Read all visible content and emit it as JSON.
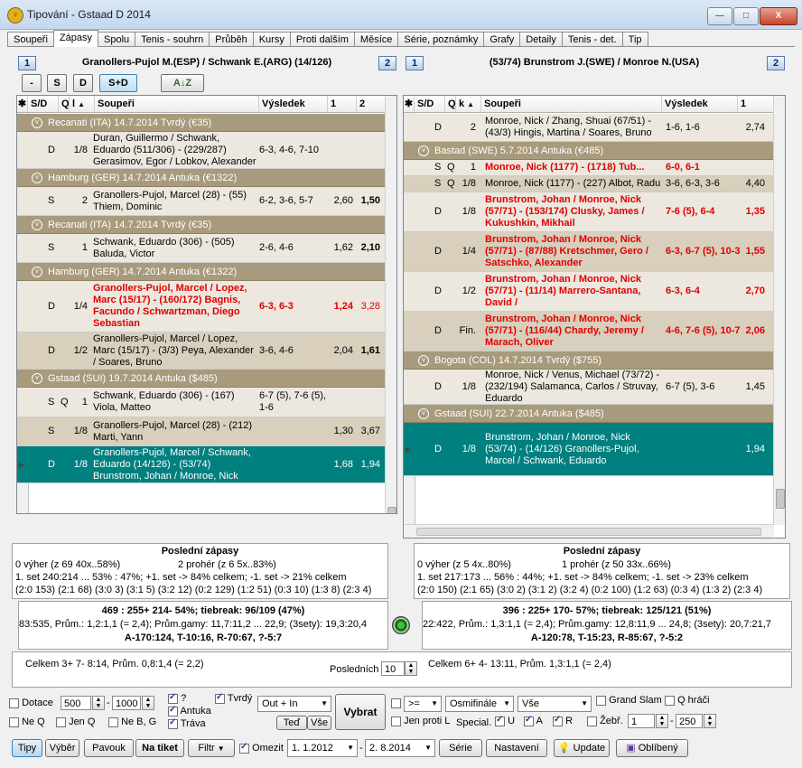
{
  "window": {
    "title": "Tipování - Gstaad D 2014",
    "min": "—",
    "max": "□",
    "close": "X"
  },
  "tabs": [
    "Soupeři",
    "Zápasy",
    "Spolu",
    "Tenis - souhrn",
    "Průběh",
    "Kursy",
    "Proti dalším",
    "Měsíce",
    "Série, poznámky",
    "Grafy",
    "Detaily",
    "Tenis - det.",
    "Tip"
  ],
  "left": {
    "num1": "1",
    "num2": "2",
    "match": "Granollers-Pujol M.(ESP) / Schwank E.(ARG) (14/126)",
    "filters": [
      "-",
      "S",
      "D",
      "S+D"
    ],
    "sort_icon": "A↓Z",
    "headers": [
      "S/D",
      "Q",
      "l",
      "Soupeři",
      "Výsledek",
      "1",
      "2"
    ],
    "rows": [
      {
        "type": "group",
        "text": "Recanati (ITA) 14.7.2014  Tvrdý  (€35)"
      },
      {
        "type": "row",
        "sd": "D",
        "q": "",
        "round": "1/8",
        "opp": "Duran, Guillermo / Schwank, Eduardo (511/306) - (229/287) Gerasimov, Egor / Lobkov, Alexander",
        "res": "6-3, 4-6, 7-10",
        "o1": "",
        "o2": "",
        "red": false,
        "bold2": false
      },
      {
        "type": "group",
        "text": "Hamburg (GER) 14.7.2014  Antuka  (€1322)"
      },
      {
        "type": "row",
        "sd": "S",
        "q": "",
        "round": "2",
        "opp": "Granollers-Pujol, Marcel (28) - (55) Thiem, Dominic",
        "res": "6-2, 3-6, 5-7",
        "o1": "2,60",
        "o2": "1,50",
        "red": false,
        "bold2": true
      },
      {
        "type": "group",
        "text": "Recanati (ITA) 14.7.2014  Tvrdý  (€35)"
      },
      {
        "type": "row",
        "sd": "S",
        "q": "",
        "round": "1",
        "opp": "Schwank, Eduardo (306) - (505) Baluda, Victor",
        "res": "2-6, 4-6",
        "o1": "1,62",
        "o2": "2,10",
        "red": false,
        "bold2": true
      },
      {
        "type": "group",
        "text": "Hamburg (GER) 14.7.2014  Antuka  (€1322)"
      },
      {
        "type": "row",
        "sd": "D",
        "q": "",
        "round": "1/4",
        "opp": "Granollers-Pujol, Marcel / Lopez, Marc (15/17) - (160/172) Bagnis, Facundo / Schwartzman, Diego Sebastian",
        "res": "6-3, 6-3",
        "o1": "1,24",
        "o2": "3,28",
        "red": true,
        "bold2": false
      },
      {
        "type": "row",
        "sd": "D",
        "q": "",
        "round": "1/2",
        "opp": "Granollers-Pujol, Marcel / Lopez, Marc (15/17) - (3/3) Peya, Alexander / Soares, Bruno",
        "res": "3-6, 4-6",
        "o1": "2,04",
        "o2": "1,61",
        "red": false,
        "bold2": true
      },
      {
        "type": "group",
        "text": "Gstaad (SUI) 19.7.2014  Antuka  ($485)"
      },
      {
        "type": "row",
        "sd": "S",
        "q": "Q",
        "round": "1",
        "opp": "Schwank, Eduardo (306) - (167) Viola, Matteo",
        "res": "6-7 (5), 7-6 (5), 1-6",
        "o1": "",
        "o2": "",
        "red": false,
        "bold2": false
      },
      {
        "type": "row",
        "sd": "S",
        "q": "",
        "round": "1/8",
        "opp": "Granollers-Pujol, Marcel (28) - (212) Marti, Yann",
        "res": "",
        "o1": "1,30",
        "o2": "3,67",
        "red": false,
        "bold2": false
      },
      {
        "type": "row",
        "sd": "D",
        "q": "",
        "round": "1/8",
        "opp": "Granollers-Pujol, Marcel / Schwank, Eduardo (14/126) - (53/74) Brunstrom, Johan / Monroe, Nick",
        "res": "",
        "o1": "1,68",
        "o2": "1,94",
        "red": false,
        "bold2": false,
        "selected": true
      }
    ]
  },
  "right": {
    "num1": "1",
    "num2": "2",
    "match": "(53/74) Brunstrom J.(SWE) / Monroe N.(USA)",
    "headers": [
      "S/D",
      "Q",
      "k",
      "Soupeři",
      "Výsledek",
      "1"
    ],
    "rows": [
      {
        "type": "row",
        "sd": "D",
        "q": "",
        "round": "2",
        "opp": "Monroe, Nick / Zhang, Shuai (67/51) - (43/3) Hingis, Martina / Soares, Bruno",
        "res": "1-6, 1-6",
        "o1": "2,74",
        "red": false
      },
      {
        "type": "group",
        "text": "Bastad (SWE) 5.7.2014  Antuka  (€485)"
      },
      {
        "type": "row",
        "sd": "S",
        "q": "Q",
        "round": "1",
        "opp": "Monroe, Nick (1177) - (1718) Tub...",
        "res": "6-0, 6-1",
        "o1": "",
        "red": true
      },
      {
        "type": "row",
        "sd": "S",
        "q": "Q",
        "round": "1/8",
        "opp": "Monroe, Nick (1177) - (227) Albot, Radu",
        "res": "3-6, 6-3, 3-6",
        "o1": "4,40",
        "red": false
      },
      {
        "type": "row",
        "sd": "D",
        "q": "",
        "round": "1/8",
        "opp": "Brunstrom, Johan / Monroe, Nick (57/71) - (153/174) Clusky, James / Kukushkin, Mikhail",
        "res": "7-6 (5), 6-4",
        "o1": "1,35",
        "red": true
      },
      {
        "type": "row",
        "sd": "D",
        "q": "",
        "round": "1/4",
        "opp": "Brunstrom, Johan / Monroe, Nick (57/71) - (87/88) Kretschmer, Gero / Satschko, Alexander",
        "res": "6-3, 6-7 (5), 10-3",
        "o1": "1,55",
        "red": true
      },
      {
        "type": "row",
        "sd": "D",
        "q": "",
        "round": "1/2",
        "opp": "Brunstrom, Johan / Monroe, Nick (57/71) - (11/14) Marrero-Santana, David /",
        "res": "6-3, 6-4",
        "o1": "2,70",
        "red": true
      },
      {
        "type": "row",
        "sd": "D",
        "q": "",
        "round": "Fin.",
        "opp": "Brunstrom, Johan / Monroe, Nick (57/71) - (116/44) Chardy, Jeremy / Marach, Oliver",
        "res": "4-6, 7-6 (5), 10-7",
        "o1": "2,06",
        "red": true
      },
      {
        "type": "group",
        "text": "Bogota (COL) 14.7.2014  Tvrdý  ($755)"
      },
      {
        "type": "row",
        "sd": "D",
        "q": "",
        "round": "1/8",
        "opp": "Monroe, Nick / Venus, Michael (73/72) - (232/194) Salamanca, Carlos / Struvay, Eduardo",
        "res": "6-7 (5), 3-6",
        "o1": "1,45",
        "red": false
      },
      {
        "type": "group",
        "text": "Gstaad (SUI) 22.7.2014  Antuka  ($485)"
      },
      {
        "type": "row",
        "sd": "D",
        "q": "",
        "round": "1/8",
        "opp": "Brunstrom, Johan / Monroe, Nick (53/74) - (14/126) Granollers-Pujol, Marcel / Schwank, Eduardo",
        "res": "",
        "o1": "1,94",
        "red": false,
        "selected": true
      }
    ]
  },
  "stats_left": {
    "title": "Poslední zápasy",
    "l1a": "0 výher (z 69 40x..58%)",
    "l1b": "2 prohér (z 6 5x..83%)",
    "l2": "1. set   240:214 ... 53% : 47%; +1. set -> 84% celkem; -1. set -> 21% celkem",
    "l3": "(2:0 153) (2:1 68) (3:0 3) (3:1 5) (3:2 12) (0:2 129) (1:2 51) (0:3 10) (1:3 8) (2:3 4)"
  },
  "stats_right": {
    "title": "Poslední zápasy",
    "l1a": "0 výher (z 5 4x..80%)",
    "l1b": "1 prohér (z 50 33x..66%)",
    "l2": "1. set   217:173 ... 56% : 44%; +1. set -> 84% celkem; -1. set -> 23% celkem",
    "l3": "(2:0 150) (2:1 65) (3:0 2) (3:1 2) (3:2 4) (0:2 100) (1:2 63) (0:3 4) (1:3 2) (2:3 4)"
  },
  "totals_left": {
    "l1": "469 : 255+  214-  54%; tiebreak: 96/109 (47%)",
    "l2": "83:535, Prům.: 1,2:1,1 (= 2,4);  Prům.gamy: 11,7:11,2 ... 22,9;  (3sety): 19,3:20,4",
    "l3": "A-170:124, T-10:16, R-70:67, ?-5:7"
  },
  "totals_right": {
    "l1": "396 : 225+  170-  57%; tiebreak: 125/121 (51%)",
    "l2": "22:422, Prům.: 1,3:1,1 (= 2,4);  Prům.gamy: 12,8:11,9 ... 24,8;  (3sety): 20,7:21,7",
    "l3": "A-120:78, T-15:23, R-85:67, ?-5:2"
  },
  "celkem": {
    "left": "Celkem  3+  7-   8:14,  Prům. 0,8:1,4 (= 2,2)",
    "posledni_label": "Posledních",
    "posledni_value": "10",
    "right": "Celkem  6+  4-   13:11,  Prům. 1,3:1,1 (= 2,4)"
  },
  "controls": {
    "dotace": "Dotace",
    "dotace_from": "500",
    "dotace_to": "1000",
    "neq": "Ne Q",
    "jenq": "Jen Q",
    "nebg": "Ne B, G",
    "q": "?",
    "antuka": "Antuka",
    "trava": "Tráva",
    "tvrdy": "Tvrdý",
    "outin": "Out + In",
    "ted": "Teď",
    "vse": "Vše",
    "vybrat": "Vybrat",
    "cmp": ">=",
    "round_sel": "Osmifinále",
    "vse_sel": "Vše",
    "grand": "Grand Slam",
    "qhraci": "Q hráči",
    "jen_proti_l": "Jen proti L",
    "special": "Special.",
    "u": "U",
    "a": "A",
    "r": "R",
    "zebr": "Žebř.",
    "zebr_from": "1",
    "zebr_to": "250"
  },
  "bottom": {
    "tipy": "Tipy",
    "vyber": "Výběr",
    "pavouk": "Pavouk",
    "natiket": "Na tiket",
    "filtr": "Filtr",
    "omezit": "Omezit",
    "date_from": "1.  1.2012",
    "date_to": "2.  8.2014",
    "serie": "Série",
    "nastaveni": "Nastavení",
    "update": "Update",
    "oblibeny": "Oblíbený"
  }
}
